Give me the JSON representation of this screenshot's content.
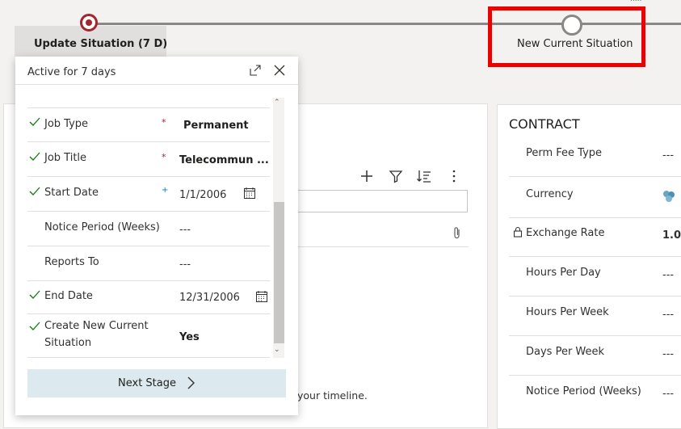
{
  "header": {
    "active_stage_label": "Update Situation  (7 D)",
    "next_stage_label": "New Current Situation"
  },
  "flyout": {
    "header_text": "Active for 7 days",
    "fields": [
      {
        "label": "Job Type",
        "value": "Permanent",
        "checked": true,
        "required": true,
        "bold": true
      },
      {
        "label": "Job Title",
        "value": "Telecommun ...",
        "checked": true,
        "required": true,
        "bold": true
      },
      {
        "label": "Start Date",
        "value": "1/1/2006",
        "checked": true,
        "recommended": true,
        "calendar": true
      },
      {
        "label": "Notice Period (Weeks)",
        "value": "---"
      },
      {
        "label": "Reports To",
        "value": "---"
      },
      {
        "label": "End Date",
        "value": "12/31/2006",
        "checked": true,
        "calendar": true
      },
      {
        "label_line1": "Create New Current",
        "label_line2": "Situation",
        "value": "Yes",
        "checked": true,
        "bold": true
      }
    ],
    "next_stage_button": "Next Stage"
  },
  "timeline": {
    "empty_text_fragment": "your timeline."
  },
  "contract": {
    "title": "CONTRACT",
    "rows": [
      {
        "label": "Perm Fee Type",
        "value": "---"
      },
      {
        "label": "Currency",
        "value": ""
      },
      {
        "label": "Exchange Rate",
        "value": "1.0"
      },
      {
        "label": "Hours Per Day",
        "value": "---"
      },
      {
        "label": "Hours Per Week",
        "value": "---"
      },
      {
        "label": "Days Per Week",
        "value": "---"
      },
      {
        "label": "Notice Period (Weeks)",
        "value": "---"
      }
    ]
  },
  "colors": {
    "active_stage": "#a4262c",
    "highlight": "#ee0000",
    "required_marker": "#a4262c",
    "button_bg": "#dce9ee"
  }
}
